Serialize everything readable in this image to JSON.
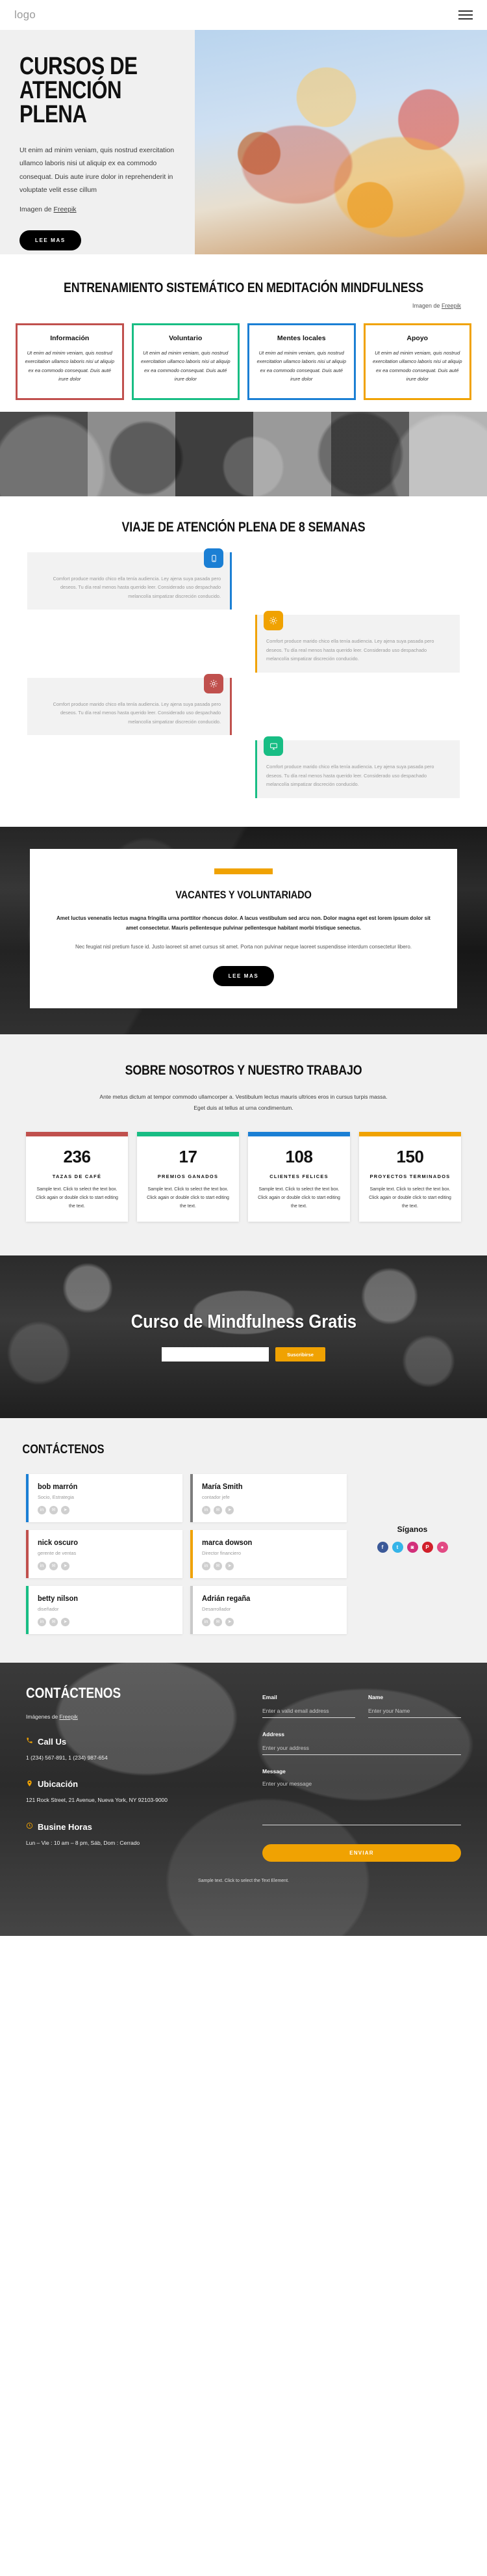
{
  "header": {
    "logo": "logo",
    "menu_icon": "hamburger-menu-icon"
  },
  "hero": {
    "title": "CURSOS DE\nATENCIÓN PLENA",
    "paragraph": "Ut enim ad minim veniam, quis nostrud exercitation ullamco laboris nisi ut aliquip ex ea commodo consequat. Duis aute irure dolor in reprehenderit in voluptate velit esse cillum",
    "credit_prefix": "Imagen de ",
    "credit_link": "Freepik",
    "cta": "LEE MAS"
  },
  "training": {
    "title": "ENTRENAMIENTO SISTEMÁTICO EN MEDITACIÓN MINDFULNESS",
    "credit_prefix": "Imagen de ",
    "credit_link": "Freepik",
    "cards": [
      {
        "title": "Información",
        "text": "Ut enim ad minim veniam, quis nostrud exercitation ullamco laboris nisi ut aliquip ex ea commodo consequat. Duis auté irure dolor",
        "color": "#c0504d"
      },
      {
        "title": "Voluntario",
        "text": "Ut enim ad minim veniam, quis nostrud exercitation ullamco laboris nisi ut aliquip ex ea commodo consequat. Duis auté irure dolor",
        "color": "#18bd84"
      },
      {
        "title": "Mentes locales",
        "text": "Ut enim ad minim veniam, quis nostrud exercitation ullamco laboris nisi ut aliquip ex ea commodo consequat. Duis auté irure dolor",
        "color": "#1b7fd4"
      },
      {
        "title": "Apoyo",
        "text": "Ut enim ad minim veniam, quis nostrud exercitation ullamco laboris nisi ut aliquip ex ea commodo consequat. Duis auté irure dolor",
        "color": "#f0a202"
      }
    ]
  },
  "journey": {
    "title": "VIAJE DE ATENCIÓN PLENA DE 8 SEMANAS",
    "items": [
      {
        "icon": "mobile-phone-icon",
        "color": "#1b7fd4",
        "side": "left",
        "text": "Comfort produce marido chico ella tenía audiencia. Ley ajena suya pasada pero deseos. Tu día real menos hasta querido leer. Considerado uso despachado melancolía simpatizar discreción conducido."
      },
      {
        "icon": "gear-icon",
        "color": "#f0a202",
        "side": "right",
        "text": "Comfort produce marido chico ella tenía audiencia. Ley ajena suya pasada pero deseos. Tu día real menos hasta querido leer. Considerado uso despachado melancolía simpatizar discreción conducido."
      },
      {
        "icon": "settings-icon",
        "color": "#c0504d",
        "side": "left",
        "text": "Comfort produce marido chico ella tenía audiencia. Ley ajena suya pasada pero deseos. Tu día real menos hasta querido leer. Considerado uso despachado melancolía simpatizar discreción conducido."
      },
      {
        "icon": "monitor-icon",
        "color": "#18bd84",
        "side": "right",
        "text": "Comfort produce marido chico ella tenía audiencia. Ley ajena suya pasada pero deseos. Tu día real menos hasta querido leer. Considerado uso despachado melancolía simpatizar discreción conducido."
      }
    ]
  },
  "vacancies": {
    "accent_color": "#f0a202",
    "title": "VACANTES Y VOLUNTARIADO",
    "lead": "Amet luctus venenatis lectus magna fringilla urna porttitor rhoncus dolor. A lacus vestibulum sed arcu non. Dolor magna eget est lorem ipsum dolor sit amet consectetur. Mauris pellentesque pulvinar pellentesque habitant morbi tristique senectus.",
    "body": "Nec feugiat nisl pretium fusce id. Justo laoreet sit amet cursus sit amet. Porta non pulvinar neque laoreet suspendisse interdum consectetur libero.",
    "cta": "LEE MAS"
  },
  "stats": {
    "title": "SOBRE NOSOTROS Y NUESTRO TRABAJO",
    "lead": "Ante metus dictum at tempor commodo ullamcorper a. Vestibulum lectus mauris ultrices eros in cursus turpis massa. Eget duis at tellus at urna condimentum.",
    "cards": [
      {
        "number": "236",
        "label": "TAZAS DE CAFÉ",
        "text": "Sample text. Click to select the text box. Click again or double click to start editing the text.",
        "color": "#c0504d"
      },
      {
        "number": "17",
        "label": "PREMIOS GANADOS",
        "text": "Sample text. Click to select the text box. Click again or double click to start editing the text.",
        "color": "#18bd84"
      },
      {
        "number": "108",
        "label": "CLIENTES FELICES",
        "text": "Sample text. Click to select the text box. Click again or double click to start editing the text.",
        "color": "#1b7fd4"
      },
      {
        "number": "150",
        "label": "PROYECTOS TERMINADOS",
        "text": "Sample text. Click to select the text box. Click again or double click to start editing the text.",
        "color": "#f0a202"
      }
    ]
  },
  "free_course": {
    "title": "Curso de Mindfulness Gratis",
    "input_value": "",
    "input_placeholder": "",
    "cta": "Suscribirse",
    "cta_color": "#f0a202"
  },
  "team": {
    "title": "CONTÁCTENOS",
    "members": [
      {
        "name": "bob marrón",
        "role": "Socio, Estrategia",
        "color": "#1b7fd4"
      },
      {
        "name": "María Smith",
        "role": "contador jefe",
        "color": "#7c7c7c"
      },
      {
        "name": "nick oscuro",
        "role": "gerente de ventas",
        "color": "#c0504d"
      },
      {
        "name": "marca dowson",
        "role": "Director financiero",
        "color": "#f0a202"
      },
      {
        "name": "betty nilson",
        "role": "diseñador",
        "color": "#18bd84"
      },
      {
        "name": "Adrián regaña",
        "role": "Desarrollador",
        "color": "#c9c9c9"
      }
    ],
    "social_icons": [
      "linkedin-icon",
      "email-icon",
      "telegram-icon"
    ],
    "follow_title": "Síganos",
    "follow": [
      {
        "icon": "facebook-icon",
        "glyph": "f",
        "color": "#3b5998"
      },
      {
        "icon": "twitter-icon",
        "glyph": "t",
        "color": "#35b4e8"
      },
      {
        "icon": "instagram-icon",
        "glyph": "◙",
        "color": "#d22f7a"
      },
      {
        "icon": "pinterest-icon",
        "glyph": "P",
        "color": "#d11f2a"
      },
      {
        "icon": "dribbble-icon",
        "glyph": "●",
        "color": "#e24a84"
      }
    ]
  },
  "footer": {
    "title": "CONTÁCTENOS",
    "credit_prefix": "Imágenes de ",
    "credit_link": "Freepik",
    "call_title": "Call Us",
    "call_value": "1 (234) 567-891, 1 (234) 987-654",
    "location_title": "Ubicación",
    "location_value": "121 Rock Street, 21 Avenue, Nueva York, NY 92103-9000",
    "hours_title": "Busine Horas",
    "hours_value": "Lun – Vie : 10 am – 8 pm, Sáb, Dom : Cerrado",
    "form": {
      "email_label": "Email",
      "email_placeholder": "Enter a valid email address",
      "email_value": "",
      "name_label": "Name",
      "name_placeholder": "Enter your Name",
      "name_value": "",
      "address_label": "Address",
      "address_placeholder": "Enter your address",
      "address_value": "",
      "message_label": "Message",
      "message_placeholder": "Enter your message",
      "message_value": "",
      "submit": "ENVIAR"
    },
    "bottom_note": "Sample text. Click to select the Text Element."
  }
}
